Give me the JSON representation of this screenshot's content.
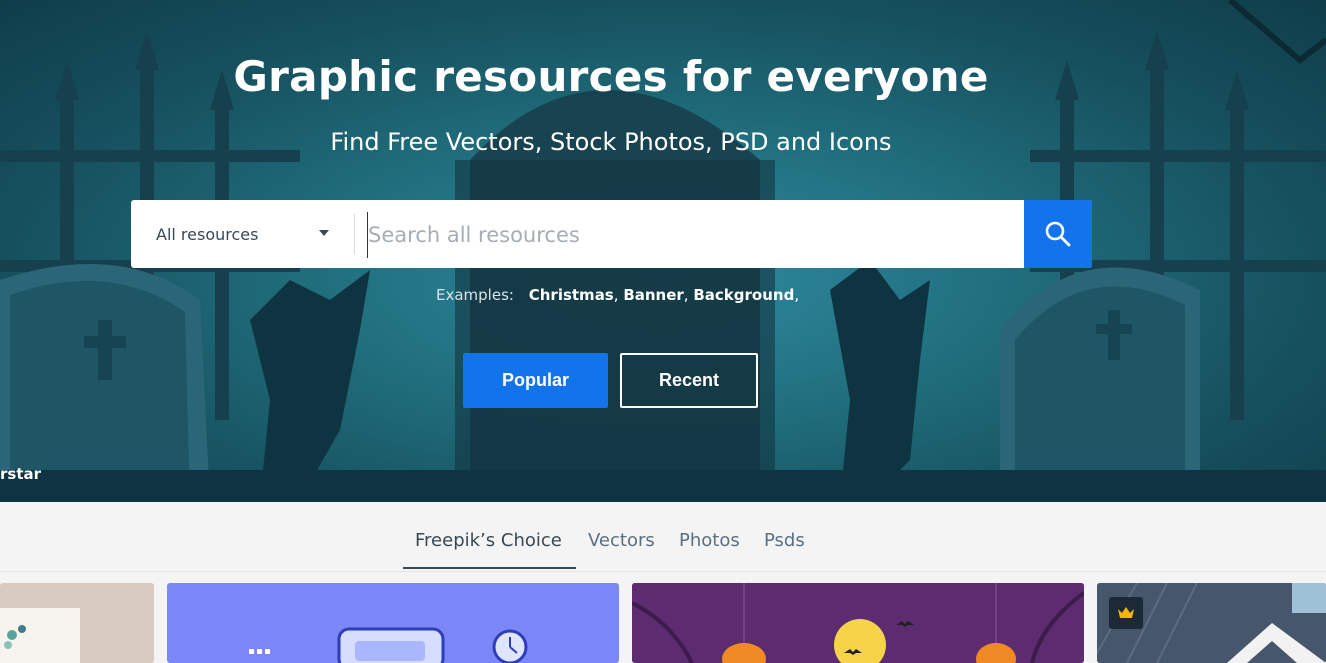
{
  "hero": {
    "title": "Graphic resources for everyone",
    "subtitle": "Find Free Vectors, Stock Photos, PSD and Icons",
    "author_credit": "rstar"
  },
  "search": {
    "resource_type": "All resources",
    "placeholder": "Search all resources",
    "button_icon": "search-icon"
  },
  "examples": {
    "label": "Examples:",
    "tags": [
      "Christmas",
      "Banner",
      "Background"
    ]
  },
  "buttons": {
    "popular": "Popular",
    "recent": "Recent"
  },
  "tabs": [
    {
      "label": "Freepik’s Choice",
      "active": true
    },
    {
      "label": "Vectors",
      "active": false
    },
    {
      "label": "Photos",
      "active": false
    },
    {
      "label": "Psds",
      "active": false
    }
  ],
  "cards": [
    {
      "theme": "floral-stationery"
    },
    {
      "theme": "mobile-app-illustration"
    },
    {
      "theme": "halloween-pumpkins",
      "icon": "bat-icon"
    },
    {
      "theme": "house-photo",
      "badge_icon": "crown-icon"
    }
  ],
  "colors": {
    "accent": "#1273eb",
    "hero_dark": "#0f3d4a",
    "hero_mid": "#21707f",
    "tab_text": "#5a6f80",
    "tab_active": "#374957"
  }
}
